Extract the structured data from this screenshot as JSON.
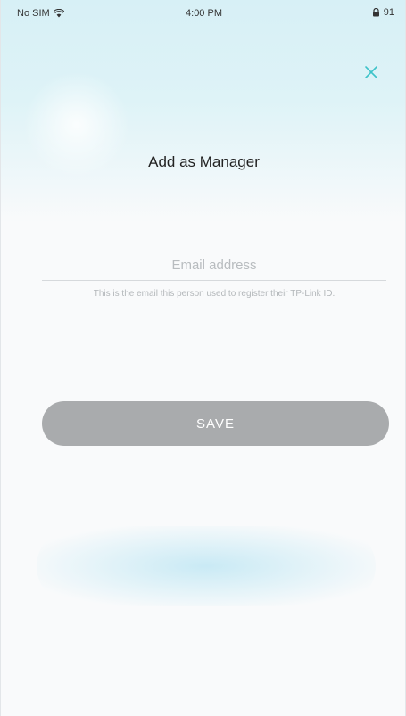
{
  "status_bar": {
    "carrier": "No SIM",
    "time": "4:00 PM",
    "battery_label": "91"
  },
  "header": {
    "title": "Add as Manager"
  },
  "form": {
    "email_placeholder": "Email address",
    "email_value": "",
    "helper_text": "This is the email this person used to register their TP-Link ID.",
    "save_label": "SAVE"
  },
  "icons": {
    "wifi": "wifi-icon",
    "lock": "lock-icon",
    "battery": "battery-icon",
    "close": "close-icon"
  },
  "colors": {
    "accent": "#3ec3c9",
    "save_disabled": "#a9abad",
    "header_gradient": "#d7f0f6"
  }
}
